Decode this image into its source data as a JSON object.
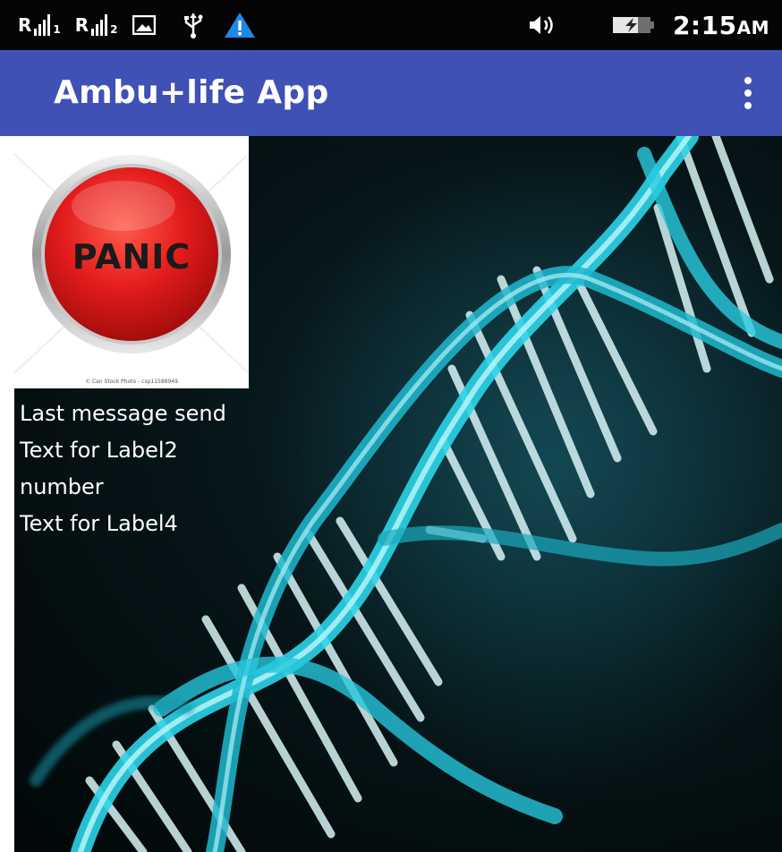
{
  "status_bar": {
    "sim1": "R",
    "sim1_index": "1",
    "sim2": "R",
    "sim2_index": "2",
    "time": "2:15",
    "ampm": "AM",
    "icons": [
      "signal-icon",
      "signal-icon",
      "image-notification-icon",
      "usb-icon",
      "warning-icon",
      "volume-icon",
      "battery-charging-icon"
    ]
  },
  "app_bar": {
    "title": "Ambu+life App",
    "menu_icon": "overflow-menu-icon"
  },
  "panic_button": {
    "label": "PANIC",
    "credit": "© Can Stock Photo - csp11588949"
  },
  "labels": {
    "last_message": "Last message send",
    "label2": "Text for Label2",
    "number": "number",
    "label4": "Text for Label4"
  },
  "colors": {
    "app_bar": "#3f51b5",
    "status_bar": "#050505",
    "panic_red": "#e21b1b",
    "dna_cyan": "#2bd4e8"
  }
}
